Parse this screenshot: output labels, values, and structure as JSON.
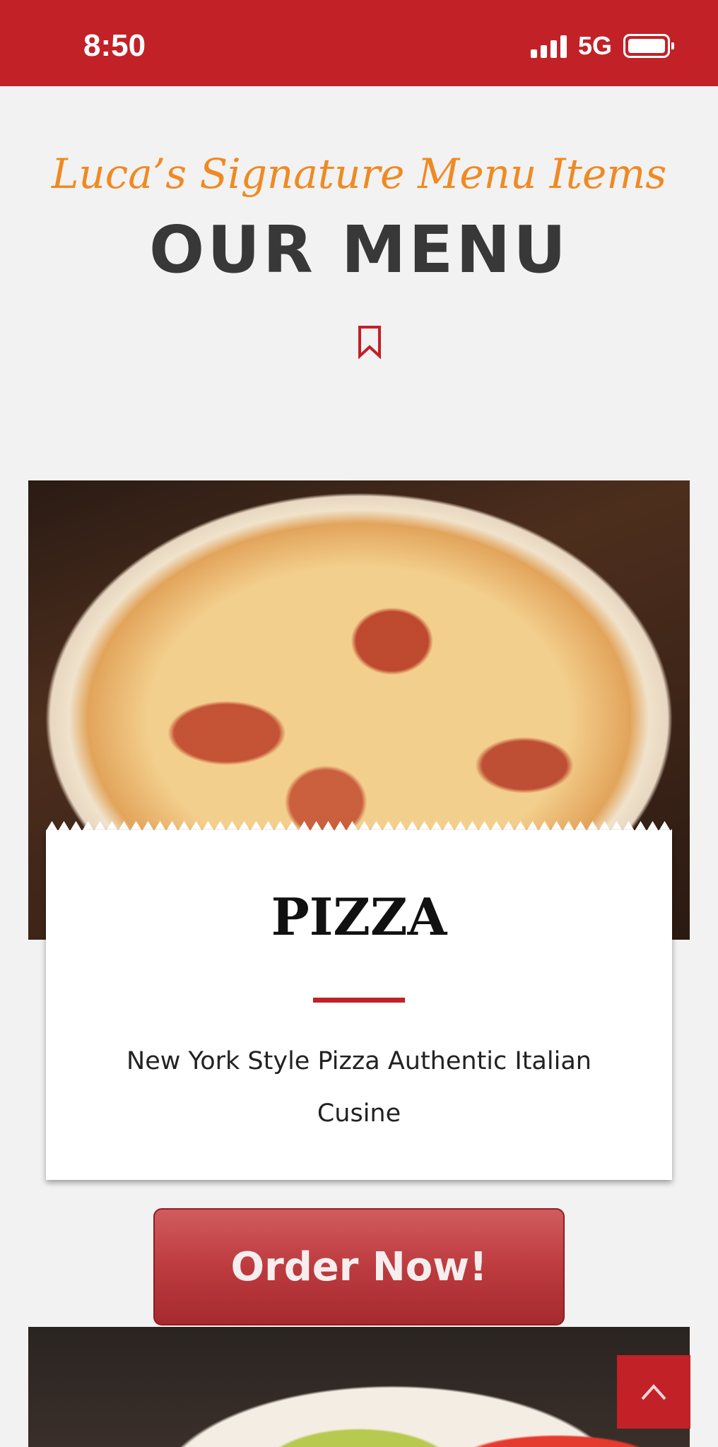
{
  "status_bar": {
    "time": "8:50",
    "network": "5G",
    "signal_icon": "cellular-signal-icon",
    "battery_icon": "battery-icon"
  },
  "section": {
    "subtitle": "Luca’s Signature Menu Items",
    "heading": "OUR MENU",
    "icon": "bookmark-icon"
  },
  "menu_item": {
    "title": "PIZZA",
    "description": "New York Style Pizza Authentic Italian Cusine",
    "image": "pizza-slice-photo"
  },
  "order_button": {
    "label": "Order Now!"
  },
  "back_to_top": {
    "icon": "chevron-up-icon"
  },
  "colors": {
    "brand_red": "#c22127",
    "accent_orange": "#ef8a23",
    "heading_dark": "#383838"
  }
}
